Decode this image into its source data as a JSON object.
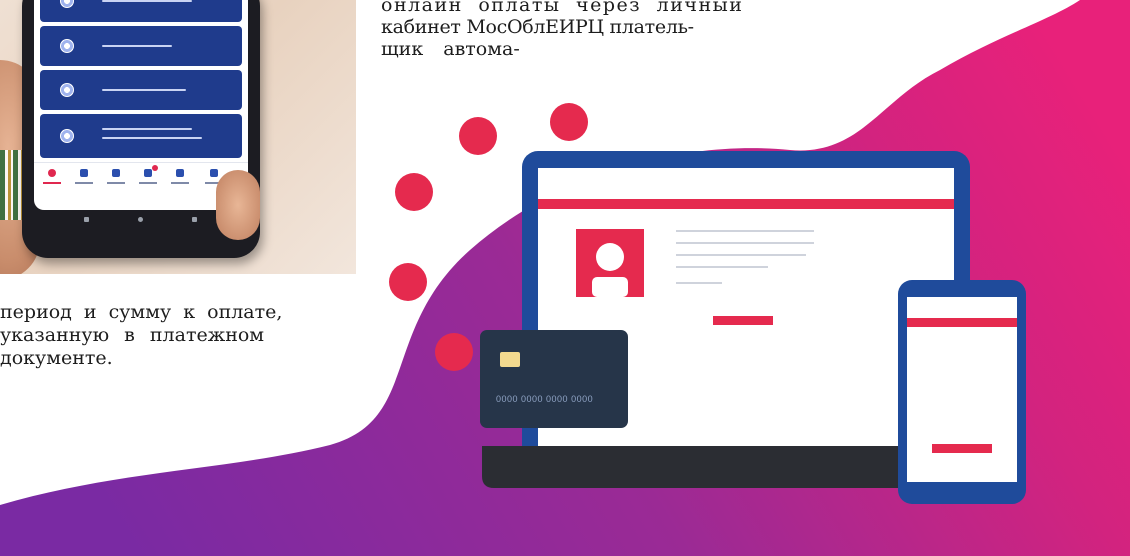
{
  "article": {
    "top_lines": [
      "онлайн оплаты через личный",
      "кабинет МосОблЕИРЦ платель-",
      "щик автома-"
    ],
    "bottom_lines": [
      "период и сумму к оплате,",
      "указанную в платежном",
      "документе."
    ]
  },
  "illustration": {
    "card_number": "0000 0000 0000 0000",
    "colors": {
      "accent_red": "#e52a4e",
      "laptop_frame": "#1f4b9b",
      "card": "#263549",
      "blob_purple": "#7b2c9e",
      "blob_pink": "#e3227b"
    }
  }
}
